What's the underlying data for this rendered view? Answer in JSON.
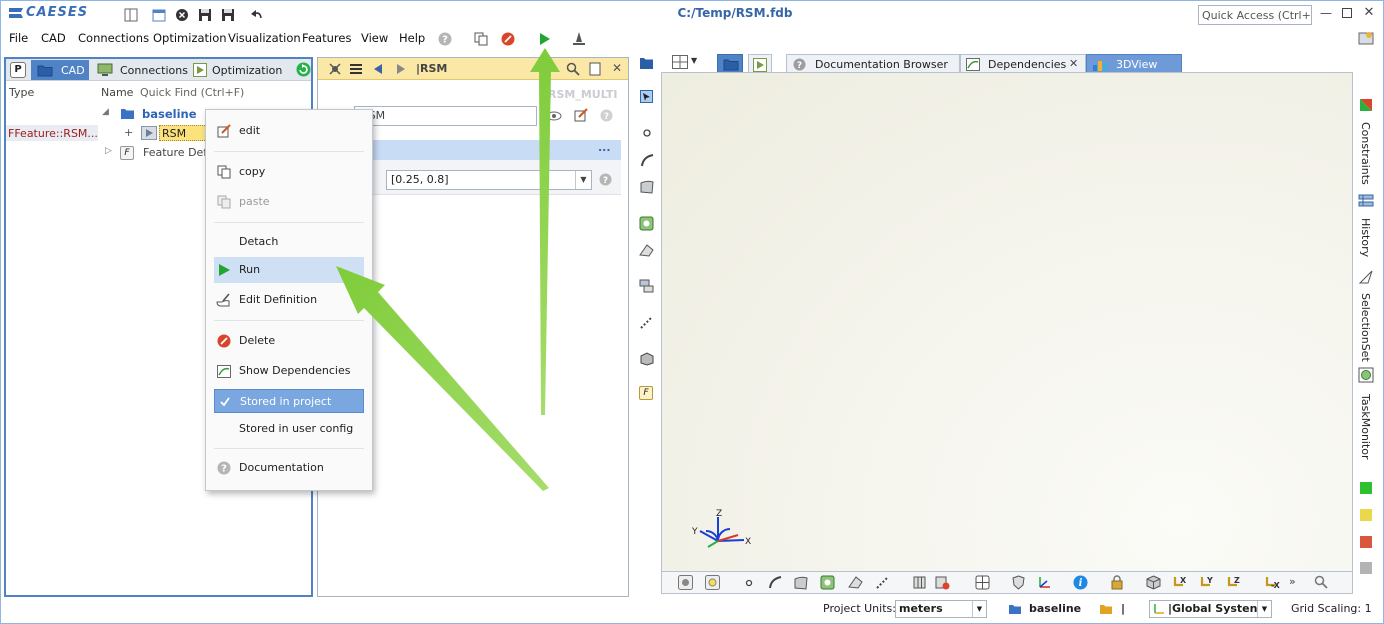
{
  "app": {
    "logo_text": "CAESES",
    "window_title": "C:/Temp/RSM.fdb",
    "quick_access_placeholder": "Quick Access (Ctrl+Q)"
  },
  "menu": [
    "File",
    "CAD",
    "Connections",
    "Optimization",
    "Visualization",
    "Features",
    "View",
    "Help"
  ],
  "left_panel": {
    "tabs": [
      "P",
      "CAD",
      "Connections",
      "Optimization"
    ],
    "columns": {
      "type": "Type",
      "name": "Name",
      "quick_find": "Quick Find (Ctrl+F)"
    },
    "tree": {
      "root": "baseline",
      "selected_type": "FFeature::RSM...",
      "selected_name": "RSM",
      "child2_icon": "F",
      "child2": "Feature Defini"
    }
  },
  "mid_panel": {
    "title": "|RSM",
    "ghost_label": "RSM_MULTI",
    "field_value": "RSM",
    "section_more": "...",
    "range_value": "[0.25, 0.8]"
  },
  "context_menu": {
    "items": [
      {
        "label": "edit",
        "icon": "edit-icon"
      },
      {
        "label": "copy",
        "icon": "copy-icon"
      },
      {
        "label": "paste",
        "icon": "paste-icon"
      },
      {
        "label": "Detach",
        "icon": ""
      },
      {
        "label": "Run",
        "icon": "play-icon"
      },
      {
        "label": "Edit Definition",
        "icon": "edit-definition-icon"
      },
      {
        "label": "Delete",
        "icon": "delete-icon"
      },
      {
        "label": "Show Dependencies",
        "icon": "dependencies-icon"
      },
      {
        "label": "Stored in project",
        "icon": "check-icon"
      },
      {
        "label": "Stored in user config",
        "icon": ""
      },
      {
        "label": "Documentation",
        "icon": "help-icon"
      }
    ]
  },
  "view_tabs": [
    "Documentation Browser",
    "Dependencies",
    "3DView"
  ],
  "right_strip": {
    "labels": [
      "Constraints",
      "History",
      "SelectionSet",
      "TaskMonitor"
    ],
    "status_colors": [
      "#2fc02f",
      "#e8d84a",
      "#d9573c",
      "#b3b3b3"
    ]
  },
  "axes": {
    "x": "X",
    "y": "Y",
    "z": "Z"
  },
  "bottom_toolbar": {
    "more": "»"
  },
  "status_bar": {
    "project_units_label": "Project Units:",
    "project_units_value": "meters",
    "baseline": "baseline",
    "folder_value": "|",
    "coord_system": "|Global Systen",
    "grid_scaling_label": "Grid Scaling: 1"
  },
  "colors": {
    "accent": "#4f83c6",
    "highlight_yellow": "#fbe7a6",
    "selection_blue": "#7ba7e1",
    "annotation_arrow": "#8cd24a",
    "run_green": "#22a532",
    "delete_red": "#d9452b"
  }
}
